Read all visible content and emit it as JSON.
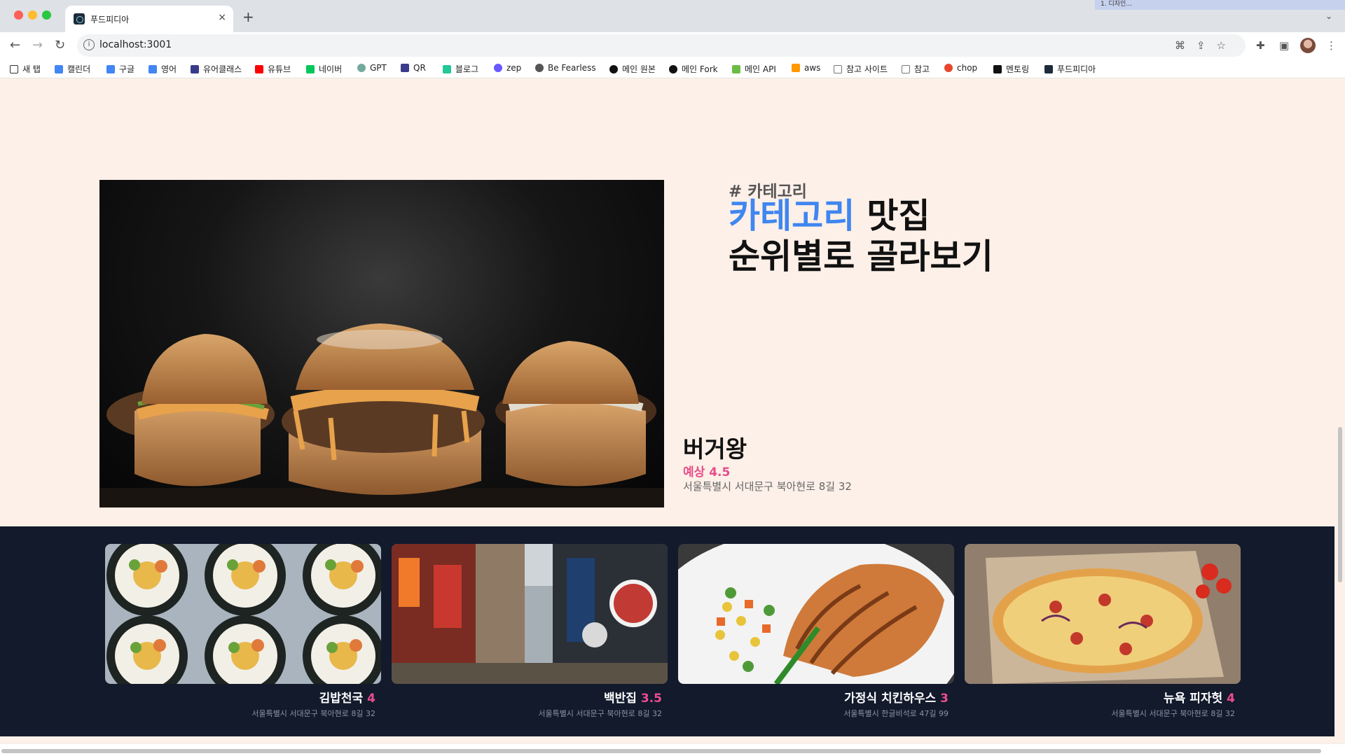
{
  "browser": {
    "tab_title": "푸드피디아",
    "tab_close": "×",
    "new_tab": "+",
    "corner_label": "1. 디자인...",
    "url": "localhost:3001",
    "bookmarks": [
      {
        "label": "새 탭",
        "icon": "square-icon",
        "color": "#333333"
      },
      {
        "label": "캘린더",
        "icon": "calendar-icon",
        "color": "#4285f4"
      },
      {
        "label": "구글",
        "icon": "google-icon",
        "color": "#4285f4"
      },
      {
        "label": "영어",
        "icon": "google-icon",
        "color": "#4285f4"
      },
      {
        "label": "유어클래스",
        "icon": "codestates-icon",
        "color": "#3a3a8c"
      },
      {
        "label": "유튜브",
        "icon": "youtube-icon",
        "color": "#ff0000"
      },
      {
        "label": "네이버",
        "icon": "naver-icon",
        "color": "#03c75a"
      },
      {
        "label": "GPT",
        "icon": "openai-icon",
        "color": "#74aa9c"
      },
      {
        "label": "QR",
        "icon": "codestates-icon",
        "color": "#3a3a8c"
      },
      {
        "label": "블로그",
        "icon": "velog-icon",
        "color": "#20c997"
      },
      {
        "label": "zep",
        "icon": "zep-icon",
        "color": "#6758ff"
      },
      {
        "label": "Be Fearless",
        "icon": "eye-icon",
        "color": "#555555"
      },
      {
        "label": "메인 원본",
        "icon": "github-icon",
        "color": "#111111"
      },
      {
        "label": "메인 Fork",
        "icon": "github-icon",
        "color": "#111111"
      },
      {
        "label": "메인 API",
        "icon": "api-icon",
        "color": "#6bbd45"
      },
      {
        "label": "aws",
        "icon": "aws-icon",
        "color": "#ff9900"
      },
      {
        "label": "참고 사이트",
        "icon": "folder-icon",
        "color": "#777777"
      },
      {
        "label": "참고",
        "icon": "folder-icon",
        "color": "#777777"
      },
      {
        "label": "chop",
        "icon": "tomato-icon",
        "color": "#e8452c"
      },
      {
        "label": "멘토링",
        "icon": "notion-icon",
        "color": "#111111"
      },
      {
        "label": "푸드피디아",
        "icon": "foodpedia-icon",
        "color": "#1d2b3a"
      }
    ]
  },
  "hero": {
    "tag": "# 카테고리",
    "headline_accent": "카테고리",
    "headline_rest": " 맛집",
    "headline_line2": "순위별로 골라보기",
    "featured": {
      "name": "버거왕",
      "score": "예상 4.5",
      "address": "서울특별시 서대문구 북아현로 8길 32"
    }
  },
  "restaurants": [
    {
      "name": "김밥천국",
      "score": "4",
      "address": "서울특별시 서대문구 북아현로 8길 32"
    },
    {
      "name": "백반집",
      "score": "3.5",
      "address": "서울특별시 서대문구 북아현로 8길 32"
    },
    {
      "name": "가정식 치킨하우스",
      "score": "3",
      "address": "서울특별시 한글비석로 47길 99"
    },
    {
      "name": "뉴욕 피자헛",
      "score": "4",
      "address": "서울특별시 서대문구 북아현로 8길 32"
    }
  ],
  "colors": {
    "page_bg": "#fdf0e8",
    "strip_bg": "#121a2c",
    "accent_blue": "#3f86f0",
    "score_pink": "#e84b8a"
  }
}
